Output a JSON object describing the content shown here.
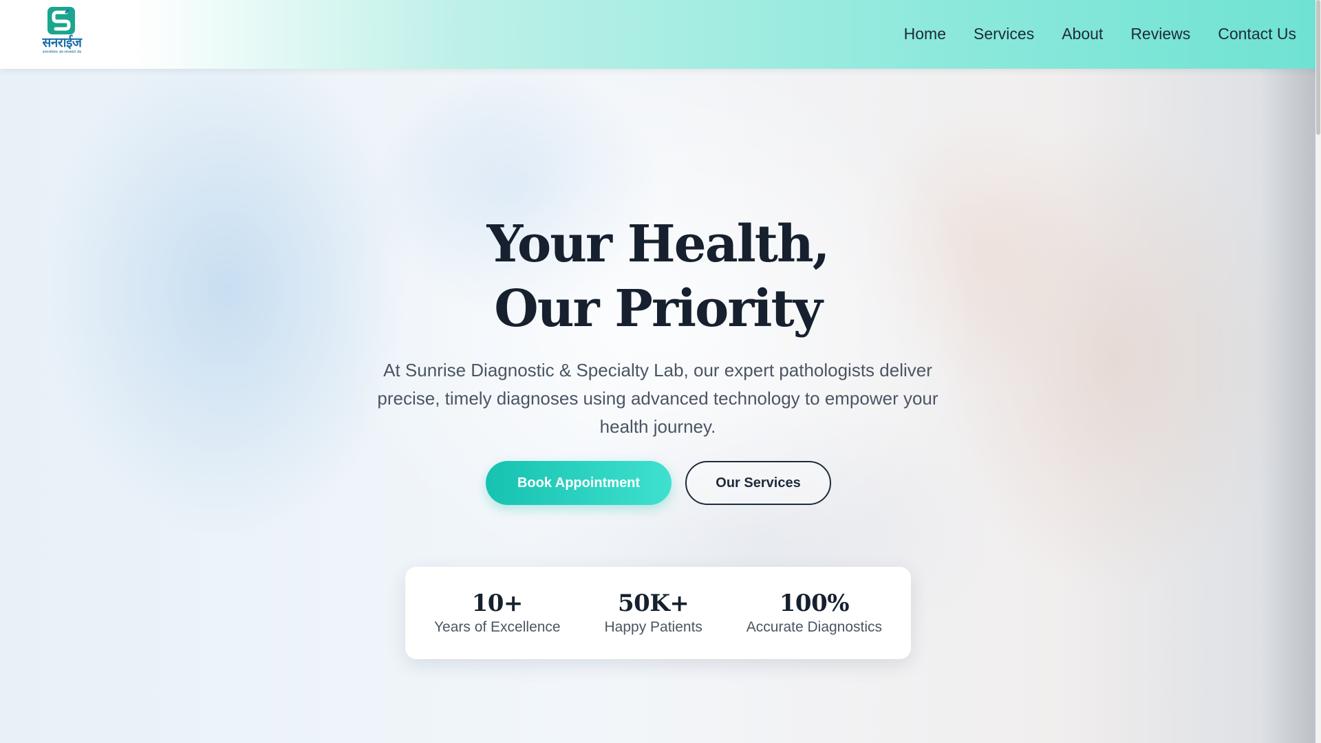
{
  "header": {
    "logo_text": "सनराईज",
    "logo_tagline": "डायग्नोस्टिक अँड स्पेशलिटी लॅब",
    "nav": [
      "Home",
      "Services",
      "About",
      "Reviews",
      "Contact Us"
    ]
  },
  "hero": {
    "title_line1": "Your Health,",
    "title_line2": "Our Priority",
    "description": "At Sunrise Diagnostic & Specialty Lab, our expert pathologists deliver precise, timely diagnoses using advanced technology to empower your health journey.",
    "primary_button": "Book Appointment",
    "secondary_button": "Our Services"
  },
  "stats": [
    {
      "value": "10+",
      "label": "Years of Excellence"
    },
    {
      "value": "50K+",
      "label": "Happy Patients"
    },
    {
      "value": "100%",
      "label": "Accurate Diagnostics"
    }
  ],
  "colors": {
    "accent": "#17c2b0",
    "text_dark": "#16202e",
    "brand_blue": "#1c6fa8"
  }
}
